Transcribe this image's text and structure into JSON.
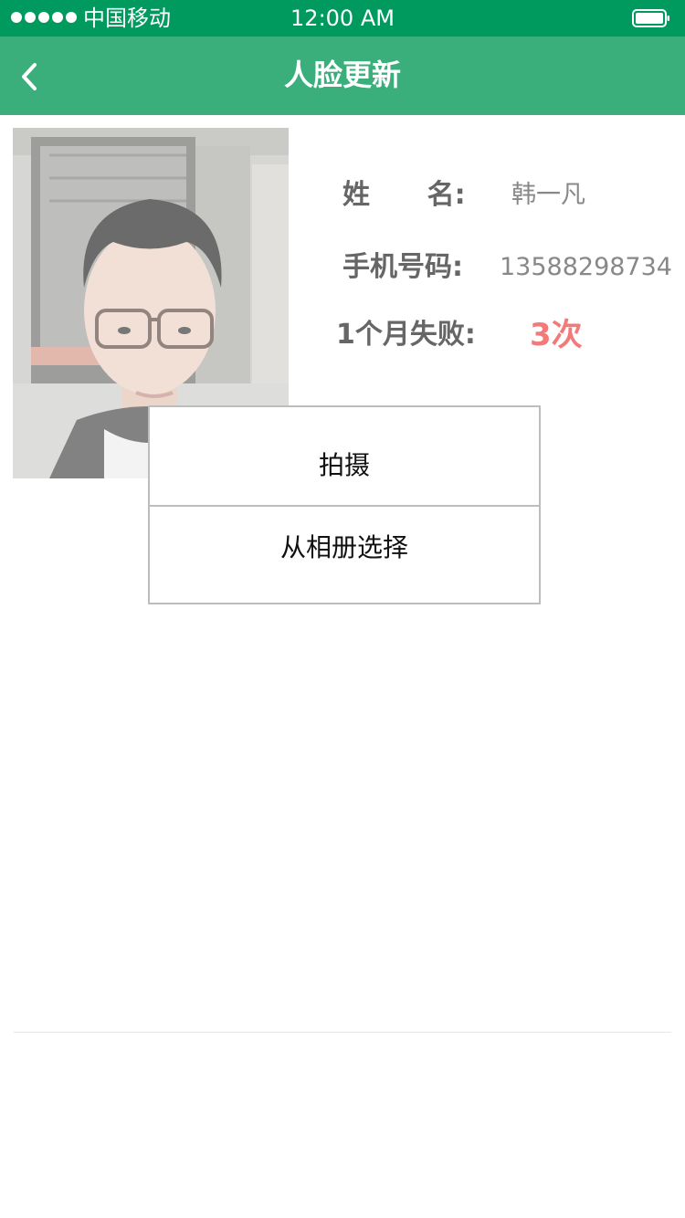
{
  "status_bar": {
    "carrier": "中国移动",
    "time": "12:00 AM",
    "signal_icon": "signal-dots-icon",
    "battery_icon": "battery-full-icon"
  },
  "nav": {
    "title": "人脸更新",
    "back_icon": "chevron-left-icon"
  },
  "profile": {
    "photo": "face-photo",
    "name_label": "姓      名:",
    "name_value": "韩一凡",
    "phone_label": "手机号码:",
    "phone_value": "13588298734",
    "fail_label": "1个月失败:",
    "fail_value": "3次"
  },
  "action_sheet": {
    "take_photo": "拍摄",
    "choose_album": "从相册选择"
  },
  "colors": {
    "status_bar": "#009a5f",
    "nav_bar": "#3aaf7c",
    "fail_accent": "#f47a7a"
  }
}
